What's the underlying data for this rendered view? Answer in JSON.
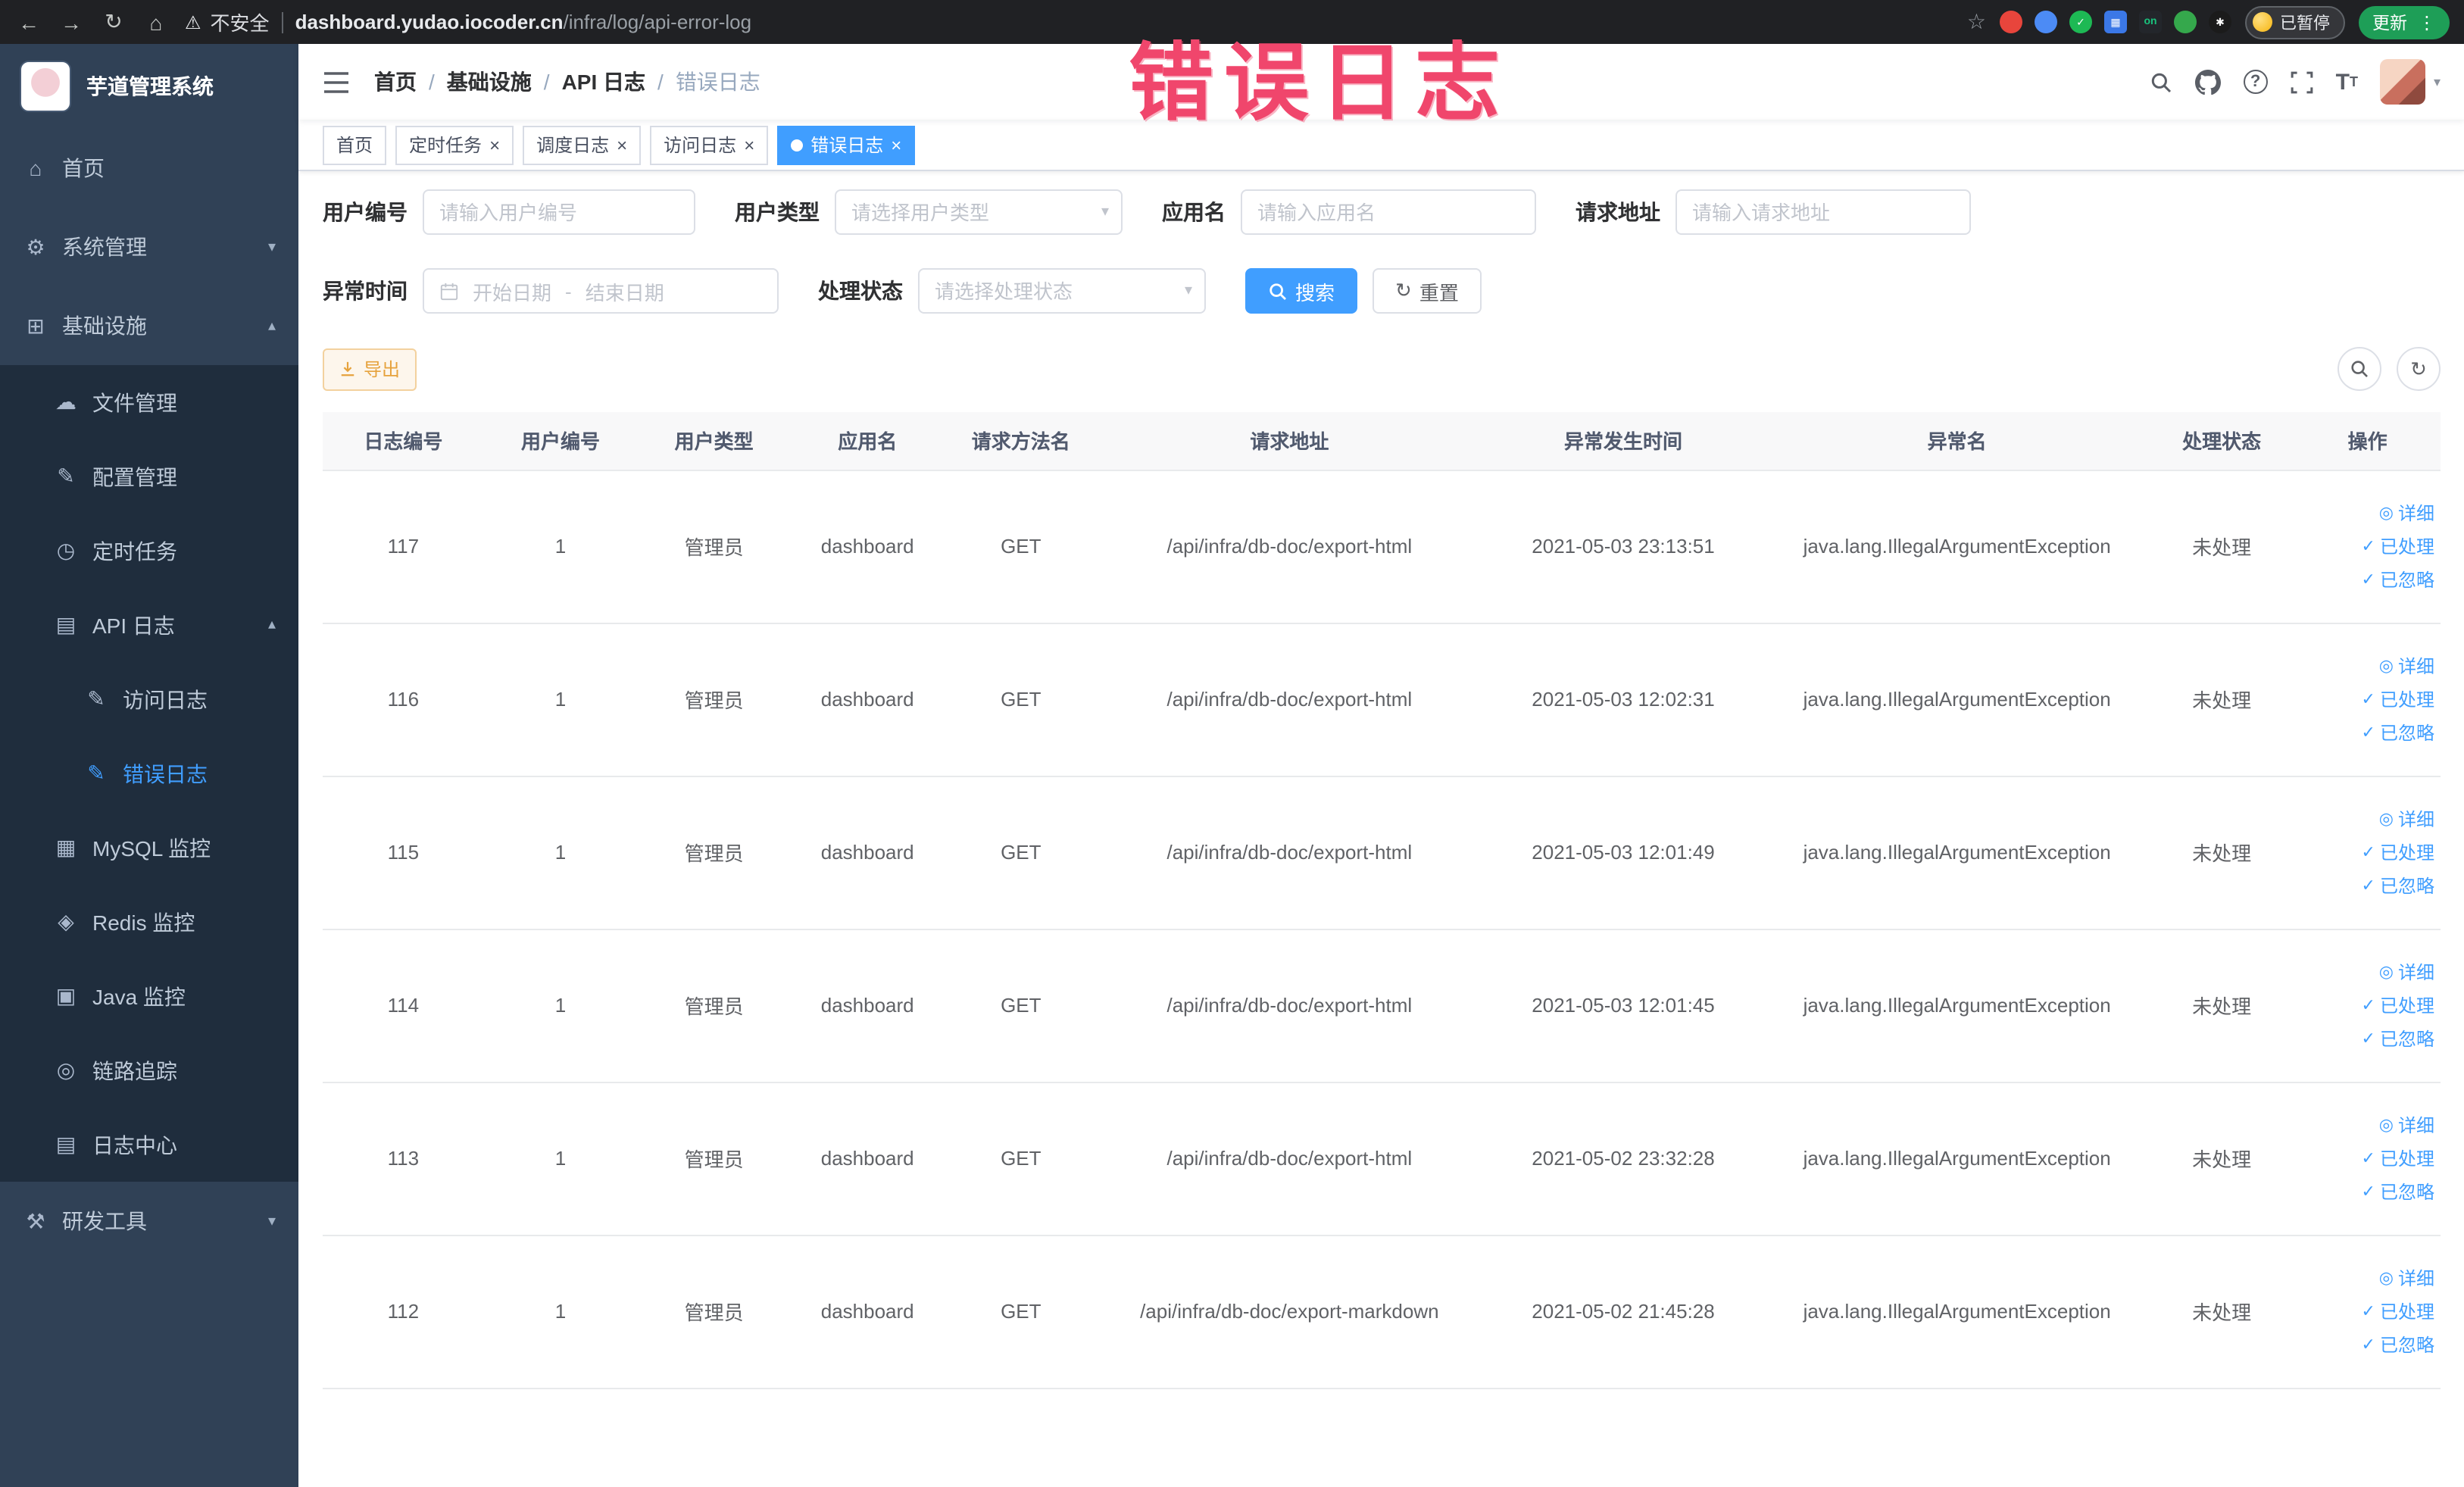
{
  "browser": {
    "security_label": "不安全",
    "url_domain": "dashboard.yudao.iocoder.cn",
    "url_path": "/infra/log/api-error-log",
    "paused_badge": "已暂停",
    "update_button": "更新",
    "extensions": [
      {
        "name": "extension-red-circle-icon",
        "color": "#e8453c",
        "glyph": "",
        "shape": "circle"
      },
      {
        "name": "extension-blue-drop-icon",
        "color": "#4c8bf5",
        "glyph": "",
        "shape": "circle"
      },
      {
        "name": "extension-green-check-icon",
        "color": "#1db954",
        "glyph": "✓",
        "shape": "circle"
      },
      {
        "name": "extension-blue-grid-icon",
        "color": "#3b78e7",
        "glyph": "▦",
        "shape": "square"
      },
      {
        "name": "extension-on-badge-icon",
        "color": "#23262b",
        "glyph": "on",
        "shape": "square"
      },
      {
        "name": "extension-leaf-icon",
        "color": "#35a84c",
        "glyph": "",
        "shape": "circle"
      },
      {
        "name": "extension-paw-icon",
        "color": "#1b1b1b",
        "glyph": "✱",
        "shape": "circle"
      }
    ]
  },
  "watermark": "错误日志",
  "sidebar": {
    "title": "芋道管理系统",
    "items": [
      {
        "key": "home",
        "label": "首页",
        "icon": "dashboard-icon",
        "glyph": "⌂",
        "level": 0
      },
      {
        "key": "system",
        "label": "系统管理",
        "icon": "gear-icon",
        "glyph": "⚙",
        "level": 0,
        "chevron": "▾"
      },
      {
        "key": "infra",
        "label": "基础设施",
        "icon": "infra-icon",
        "glyph": "⊞",
        "level": 0,
        "chevron": "▴"
      },
      {
        "key": "file",
        "label": "文件管理",
        "icon": "cloud-icon",
        "glyph": "☁",
        "level": 1
      },
      {
        "key": "config",
        "label": "配置管理",
        "icon": "edit-icon",
        "glyph": "✎",
        "level": 1
      },
      {
        "key": "job",
        "label": "定时任务",
        "icon": "clock-icon",
        "glyph": "◷",
        "level": 1
      },
      {
        "key": "api-log",
        "label": "API 日志",
        "icon": "log-icon",
        "glyph": "▤",
        "level": 1,
        "chevron": "▴"
      },
      {
        "key": "access-log",
        "label": "访问日志",
        "icon": "doc-edit-icon",
        "glyph": "✎",
        "level": 2
      },
      {
        "key": "error-log",
        "label": "错误日志",
        "icon": "doc-edit-icon",
        "glyph": "✎",
        "level": 2,
        "active": true
      },
      {
        "key": "mysql",
        "label": "MySQL 监控",
        "icon": "mysql-monitor-icon",
        "glyph": "▦",
        "level": 1
      },
      {
        "key": "redis",
        "label": "Redis 监控",
        "icon": "redis-monitor-icon",
        "glyph": "◈",
        "level": 1
      },
      {
        "key": "java",
        "label": "Java 监控",
        "icon": "java-monitor-icon",
        "glyph": "▣",
        "level": 1
      },
      {
        "key": "trace",
        "label": "链路追踪",
        "icon": "trace-icon",
        "glyph": "◎",
        "level": 1
      },
      {
        "key": "log-center",
        "label": "日志中心",
        "icon": "log-center-icon",
        "glyph": "▤",
        "level": 1
      },
      {
        "key": "dev-tools",
        "label": "研发工具",
        "icon": "tools-icon",
        "glyph": "⚒",
        "level": 0,
        "chevron": "▾"
      }
    ]
  },
  "breadcrumb": [
    "首页",
    "基础设施",
    "API 日志",
    "错误日志"
  ],
  "tabs": [
    {
      "key": "home",
      "label": "首页",
      "closable": false,
      "active": false
    },
    {
      "key": "job",
      "label": "定时任务",
      "closable": true,
      "active": false
    },
    {
      "key": "job-log",
      "label": "调度日志",
      "closable": true,
      "active": false
    },
    {
      "key": "access-log",
      "label": "访问日志",
      "closable": true,
      "active": false
    },
    {
      "key": "error-log",
      "label": "错误日志",
      "closable": true,
      "active": true
    }
  ],
  "filters": {
    "user_id": {
      "label": "用户编号",
      "placeholder": "请输入用户编号"
    },
    "user_type": {
      "label": "用户类型",
      "placeholder": "请选择用户类型"
    },
    "app_name": {
      "label": "应用名",
      "placeholder": "请输入应用名"
    },
    "request_url": {
      "label": "请求地址",
      "placeholder": "请输入请求地址"
    },
    "exception_time": {
      "label": "异常时间",
      "start_placeholder": "开始日期",
      "separator": "-",
      "end_placeholder": "结束日期"
    },
    "process_status": {
      "label": "处理状态",
      "placeholder": "请选择处理状态"
    },
    "search_button": "搜索",
    "reset_button": "重置"
  },
  "toolbar": {
    "export_button": "导出"
  },
  "table": {
    "columns": [
      "日志编号",
      "用户编号",
      "用户类型",
      "应用名",
      "请求方法名",
      "请求地址",
      "异常发生时间",
      "异常名",
      "处理状态",
      "操作"
    ],
    "row_actions": [
      {
        "key": "detail-link",
        "label": "详细",
        "icon": "eye-icon",
        "glyph": "◎"
      },
      {
        "key": "processed-link",
        "label": "已处理",
        "icon": "check-icon",
        "glyph": "✓"
      },
      {
        "key": "ignored-link",
        "label": "已忽略",
        "icon": "check-icon",
        "glyph": "✓"
      }
    ],
    "rows": [
      {
        "id": "117",
        "user_id": "1",
        "user_type": "管理员",
        "app": "dashboard",
        "method": "GET",
        "url": "/api/infra/db-doc/export-html",
        "time": "2021-05-03 23:13:51",
        "exception": "java.lang.IllegalArgumentException",
        "status": "未处理"
      },
      {
        "id": "116",
        "user_id": "1",
        "user_type": "管理员",
        "app": "dashboard",
        "method": "GET",
        "url": "/api/infra/db-doc/export-html",
        "time": "2021-05-03 12:02:31",
        "exception": "java.lang.IllegalArgumentException",
        "status": "未处理"
      },
      {
        "id": "115",
        "user_id": "1",
        "user_type": "管理员",
        "app": "dashboard",
        "method": "GET",
        "url": "/api/infra/db-doc/export-html",
        "time": "2021-05-03 12:01:49",
        "exception": "java.lang.IllegalArgumentException",
        "status": "未处理"
      },
      {
        "id": "114",
        "user_id": "1",
        "user_type": "管理员",
        "app": "dashboard",
        "method": "GET",
        "url": "/api/infra/db-doc/export-html",
        "time": "2021-05-03 12:01:45",
        "exception": "java.lang.IllegalArgumentException",
        "status": "未处理"
      },
      {
        "id": "113",
        "user_id": "1",
        "user_type": "管理员",
        "app": "dashboard",
        "method": "GET",
        "url": "/api/infra/db-doc/export-html",
        "time": "2021-05-02 23:32:28",
        "exception": "java.lang.IllegalArgumentException",
        "status": "未处理"
      },
      {
        "id": "112",
        "user_id": "1",
        "user_type": "管理员",
        "app": "dashboard",
        "method": "GET",
        "url": "/api/infra/db-doc/export-markdown",
        "time": "2021-05-02 21:45:28",
        "exception": "java.lang.IllegalArgumentException",
        "status": "未处理"
      }
    ]
  },
  "header_icons": {
    "help_glyph": "?"
  }
}
